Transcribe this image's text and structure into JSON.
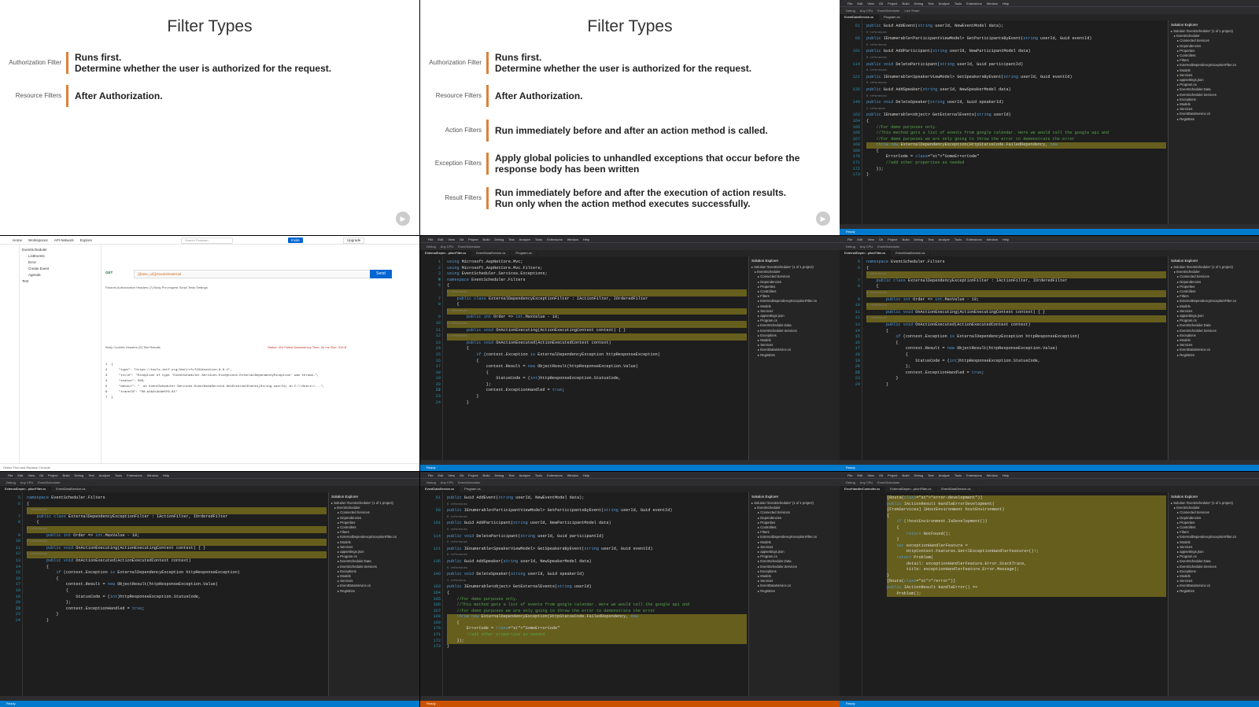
{
  "panels": {
    "slide_short": {
      "title": "Filter Types",
      "rows": [
        {
          "label": "Authorization Filter",
          "text": "Runs first.\nDetermine whether the user is authorized for the request."
        },
        {
          "label": "Resource Filters",
          "text": "After Authorization."
        }
      ]
    },
    "slide_full": {
      "title": "Filter Types",
      "rows": [
        {
          "label": "Authorization Filter",
          "text": "Runs first.\nDetermine whether the user is authorized for the request."
        },
        {
          "label": "Resource Filters",
          "text": "After Authorization."
        },
        {
          "label": "Action Filters",
          "text": "Run immediately before and after an action method is called."
        },
        {
          "label": "Exception Filters",
          "text": "Apply global policies to unhandled exceptions that occur before the response body has been written"
        },
        {
          "label": "Result Filters",
          "text": "Run immediately before and after the execution of action results.\nRun only when the action method executes successfully."
        }
      ]
    },
    "ide_menu": [
      "File",
      "Edit",
      "View",
      "Git",
      "Project",
      "Build",
      "Debug",
      "Test",
      "Analyze",
      "Tools",
      "Extensions",
      "Window",
      "Help"
    ],
    "ide_search": "Search (Ctrl+Q)",
    "ide_project": "EventScheduler",
    "ide_toolbar": [
      "Debug",
      "Any CPU",
      "EventScheduler",
      "Live Share"
    ],
    "ide_status": "Ready",
    "solution_title": "Solution Explorer",
    "solution_items": [
      "Solution 'EventScheduler' (1 of 1 project)",
      "EventScheduler",
      "Connected Services",
      "Dependencies",
      "Properties",
      "Controllers",
      "Filters",
      "ExternalDependencyExceptionFilter.cs",
      "Models",
      "Services",
      "appsettings.json",
      "Program.cs",
      "EventScheduler.Data",
      "EventScheduler.Services",
      "Exceptions",
      "Models",
      "Services",
      "EventDataService.cs",
      "Registries"
    ],
    "service_file": {
      "tabs": [
        "EventDataService.cs",
        "Program.cs"
      ],
      "lines": [
        {
          "n": "61",
          "t": "public Guid AddEvent(string userId, NewEventModel data);"
        },
        {
          "n": "",
          "t": "0 references"
        },
        {
          "n": "68",
          "t": "public IEnumerable<ParticipantViewModel> GetParticipantsByEvent(string userId, Guid eventId)"
        },
        {
          "n": "",
          "t": "0 references"
        },
        {
          "n": "101",
          "t": "public Guid AddParticipant(string userId, NewParticipantModel data)"
        },
        {
          "n": "",
          "t": "0 references"
        },
        {
          "n": "114",
          "t": "public void DeleteParticipant(string userId, Guid participantId)"
        },
        {
          "n": "",
          "t": "0 references"
        },
        {
          "n": "121",
          "t": "public IEnumerable<SpeakerViewModel> GetSpeakersByEvent(string userId, Guid eventId)"
        },
        {
          "n": "",
          "t": "0 references"
        },
        {
          "n": "136",
          "t": "public Guid AddSpeaker(string userId, NewSpeakerModel data)"
        },
        {
          "n": "",
          "t": "0 references"
        },
        {
          "n": "149",
          "t": "public void DeleteSpeaker(string userId, Guid speakerId)"
        },
        {
          "n": "",
          "t": "1 reference"
        },
        {
          "n": "163",
          "t": "public IEnumerable<object> GetExternalEvents(string userId)"
        },
        {
          "n": "164",
          "t": "{"
        },
        {
          "n": "165",
          "t": "    //For demo purposes only."
        },
        {
          "n": "166",
          "t": "    //This method gets a list of events from google calendar. Here we would call the google api and"
        },
        {
          "n": "167",
          "t": "    //For demo purposes we are only going to throw the error to demonstrate the error"
        },
        {
          "n": "168",
          "t": "    throw new ExternalDependencyException(HttpStatusCode.FailedDependency, new"
        },
        {
          "n": "169",
          "t": "    {"
        },
        {
          "n": "170",
          "t": "        ErrorCode = \"SomeErrorCode\""
        },
        {
          "n": "171",
          "t": "        //add other properties as needed"
        },
        {
          "n": "172",
          "t": "    });"
        },
        {
          "n": "173",
          "t": "}"
        }
      ]
    },
    "filter_file": {
      "tabs": [
        "ExternalDepen...ptionFilter.cs",
        "EventDataService.cs",
        "Program.cs"
      ],
      "lines": [
        {
          "n": "1",
          "t": "using Microsoft.AspNetCore.Mvc;"
        },
        {
          "n": "2",
          "t": "using Microsoft.AspNetCore.Mvc.Filters;"
        },
        {
          "n": "3",
          "t": "using EventScheduler.Services.Exceptions;"
        },
        {
          "n": "4",
          "t": ""
        },
        {
          "n": "5",
          "t": "namespace EventScheduler.Filters"
        },
        {
          "n": "6",
          "t": "{"
        },
        {
          "n": "",
          "t": "2 references"
        },
        {
          "n": "7",
          "t": "    public class ExternalDependencyExceptionFilter : IActionFilter, IOrderedFilter"
        },
        {
          "n": "8",
          "t": "    {"
        },
        {
          "n": "",
          "t": "0 references"
        },
        {
          "n": "9",
          "t": "        public int Order => int.MaxValue - 10;"
        },
        {
          "n": "10",
          "t": ""
        },
        {
          "n": "",
          "t": "0 references"
        },
        {
          "n": "11",
          "t": "        public void OnActionExecuting(ActionExecutingContext context) { }"
        },
        {
          "n": "12",
          "t": ""
        },
        {
          "n": "",
          "t": "0 references"
        },
        {
          "n": "13",
          "t": "        public void OnActionExecuted(ActionExecutedContext context)"
        },
        {
          "n": "14",
          "t": "        {"
        },
        {
          "n": "15",
          "t": "            if (context.Exception is ExternalDependencyException httpResponseException)"
        },
        {
          "n": "16",
          "t": "            {"
        },
        {
          "n": "17",
          "t": "                context.Result = new ObjectResult(httpResponseException.Value)"
        },
        {
          "n": "18",
          "t": "                {"
        },
        {
          "n": "19",
          "t": "                    StatusCode = (int)httpResponseException.StatusCode,"
        },
        {
          "n": "20",
          "t": "                };"
        },
        {
          "n": "21",
          "t": ""
        },
        {
          "n": "22",
          "t": "                context.ExceptionHandled = true;"
        },
        {
          "n": "23",
          "t": "            }"
        },
        {
          "n": "24",
          "t": "        }"
        }
      ]
    },
    "controller_file": {
      "tabs": [
        "ErrorHandlerController.cs",
        "ExternalDepen...ptionFilter.cs",
        "EventDataService.cs"
      ],
      "lines": [
        {
          "n": "",
          "t": ""
        },
        {
          "n": "",
          "t": "[Route(\"error-development\")]"
        },
        {
          "n": "",
          "t": "public IActionResult HandleErrorDevelopment("
        },
        {
          "n": "",
          "t": "[FromServices] IHostEnvironment hostEnvironment)"
        },
        {
          "n": "",
          "t": "{"
        },
        {
          "n": "",
          "t": "    if (!hostEnvironment.IsDevelopment())"
        },
        {
          "n": "",
          "t": "    {"
        },
        {
          "n": "",
          "t": "        return NotFound();"
        },
        {
          "n": "",
          "t": "    }"
        },
        {
          "n": "",
          "t": ""
        },
        {
          "n": "",
          "t": "    var exceptionHandlerFeature ="
        },
        {
          "n": "",
          "t": "        HttpContext.Features.Get<IExceptionHandlerFeature>()!;"
        },
        {
          "n": "",
          "t": ""
        },
        {
          "n": "",
          "t": "    return Problem("
        },
        {
          "n": "",
          "t": "        detail: exceptionHandlerFeature.Error.StackTrace,"
        },
        {
          "n": "",
          "t": "        title: exceptionHandlerFeature.Error.Message);"
        },
        {
          "n": "",
          "t": "}"
        },
        {
          "n": "",
          "t": ""
        },
        {
          "n": "",
          "t": "[Route(\"/error\")]"
        },
        {
          "n": "",
          "t": "public IActionResult HandleError() =>"
        },
        {
          "n": "",
          "t": "    Problem();"
        }
      ]
    },
    "postman": {
      "menu": [
        "Home",
        "Workspaces",
        "API Network",
        "Explore"
      ],
      "search": "Search Postman",
      "invite": "Invite",
      "upgrade": "Upgrade",
      "tree": [
        "EventScheduler",
        "ListEvents",
        "Error",
        "Create Event",
        "Agenda",
        "Test"
      ],
      "url": "{{base_url}}/events/external",
      "method": "GET",
      "send": "Send",
      "tabs": "Params  Authorization  Headers (7)  Body  Pre-request Script  Tests  Settings",
      "response_tabs": "Body  Cookies  Headers (5)  Test Results",
      "status": "Status: 424 Failed Dependency   Time: 34 ms   Size: 318 B",
      "response": [
        "1  {",
        "2      \"type\": \"https://tools.ietf.org/html/rfc7231#section-6.6.1\",",
        "3      \"title\": \"Exception of type 'EventScheduler.Services.Exceptions.ExternalDependencyException' was thrown.\",",
        "4      \"status\": 500,",
        "5      \"detail\": \"  at EventScheduler.Services.EventDataService.GetExternalEvents(String userId) in C:\\\\Users\\\\...\",",
        "6      \"traceId\": \"00-a1b2c3d4e5f6-01\"",
        "7  }"
      ],
      "footer": "Online   Find and Replace   Console"
    }
  }
}
